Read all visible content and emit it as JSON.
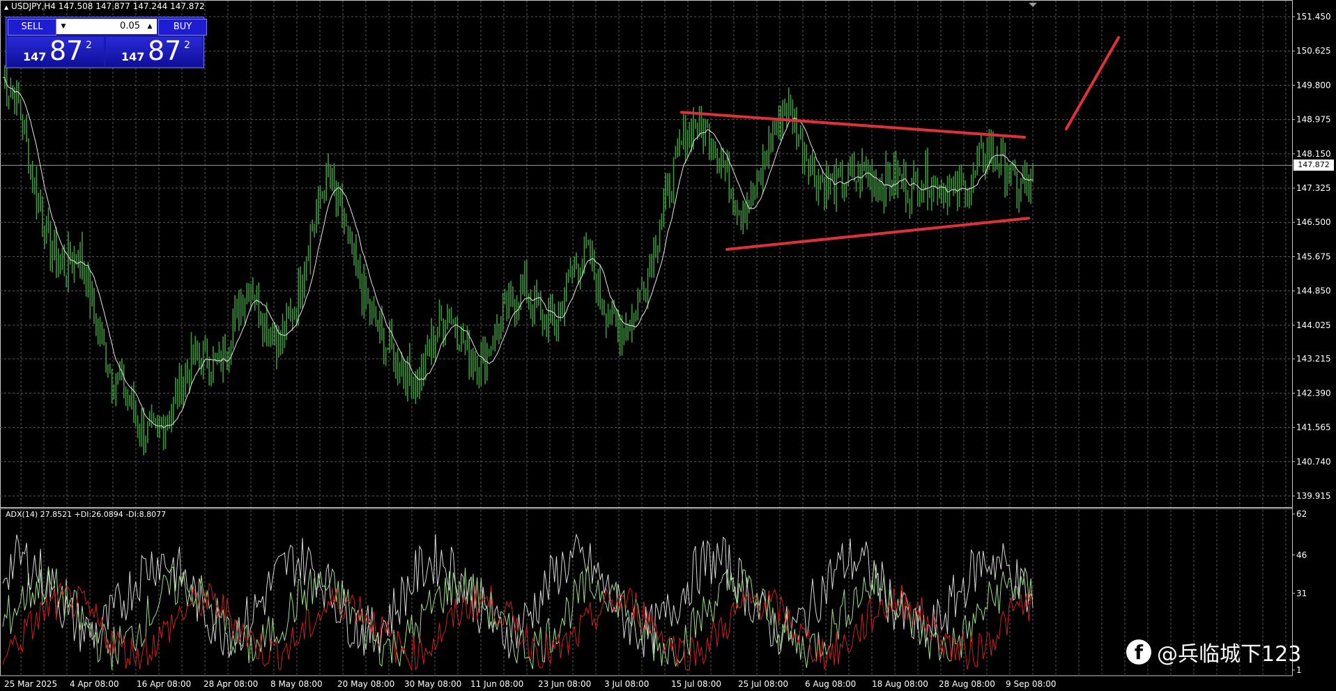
{
  "header": {
    "symbol_line": "USDJPY,H4  147.508 147.877 147.244 147.872"
  },
  "trade_panel": {
    "sell_label": "SELL",
    "buy_label": "BUY",
    "lot": "0.05",
    "sell_price_small": "147",
    "sell_price_big": "87",
    "sell_price_sup": "2",
    "buy_price_small": "147",
    "buy_price_big": "87",
    "buy_price_sup": "2"
  },
  "current_price_tag": "147.872",
  "indicator": {
    "title": "ADX(14) 27.8521 +DI:26.0894 -DI:8.8077"
  },
  "watermark": "@兵临城下123",
  "colors": {
    "candles": "#3a9a3a",
    "ma_line": "#e8e8e8",
    "trendline": "#e0303a",
    "adx": "#d8d8d8",
    "plus_di": "#9fe08a",
    "minus_di": "#d02020"
  },
  "chart_data": {
    "type": "line",
    "price_axis": [
      "151.450",
      "150.625",
      "149.800",
      "148.975",
      "148.150",
      "147.325",
      "146.500",
      "145.675",
      "144.850",
      "144.025",
      "143.215",
      "142.390",
      "141.565",
      "140.740",
      "139.915"
    ],
    "ind_axis": [
      "62",
      "46",
      "31",
      "1"
    ],
    "date_axis": [
      "25 Mar 2025",
      "4 Apr 08:00",
      "16 Apr 08:00",
      "28 Apr 08:00",
      "8 May 08:00",
      "20 May 08:00",
      "30 May 08:00",
      "11 Jun 08:00",
      "23 Jun 08:00",
      "3 Jul 08:00",
      "15 Jul 08:00",
      "25 Jul 08:00",
      "6 Aug 08:00",
      "18 Aug 08:00",
      "28 Aug 08:00",
      "9 Sep 08:00"
    ],
    "ylim": [
      139.915,
      151.45
    ],
    "price_path": [
      150.0,
      149.4,
      147.5,
      146.0,
      145.4,
      145.8,
      144.2,
      142.9,
      142.4,
      141.6,
      141.3,
      142.0,
      143.0,
      143.3,
      143.0,
      144.1,
      145.1,
      144.2,
      143.6,
      144.5,
      146.2,
      147.6,
      146.7,
      145.3,
      144.2,
      143.5,
      143.0,
      142.6,
      143.7,
      144.4,
      143.6,
      143.0,
      143.8,
      144.5,
      144.9,
      144.2,
      144.1,
      145.4,
      145.8,
      144.6,
      143.9,
      144.2,
      145.4,
      146.9,
      148.2,
      148.9,
      148.6,
      147.8,
      146.8,
      147.2,
      148.6,
      149.3,
      148.4,
      147.6,
      147.3,
      147.5,
      147.7,
      147.4,
      147.6,
      147.3,
      147.6,
      147.4,
      147.2,
      147.4,
      148.3,
      148.0,
      147.3,
      147.5
    ],
    "trendlines": [
      {
        "from": [
          0,
          149.15
        ],
        "to": [
          1,
          148.55
        ]
      },
      {
        "from": [
          0,
          145.85
        ],
        "to": [
          1,
          146.6
        ]
      },
      {
        "from": [
          0,
          148.75
        ],
        "to": [
          1,
          150.95
        ]
      }
    ]
  }
}
